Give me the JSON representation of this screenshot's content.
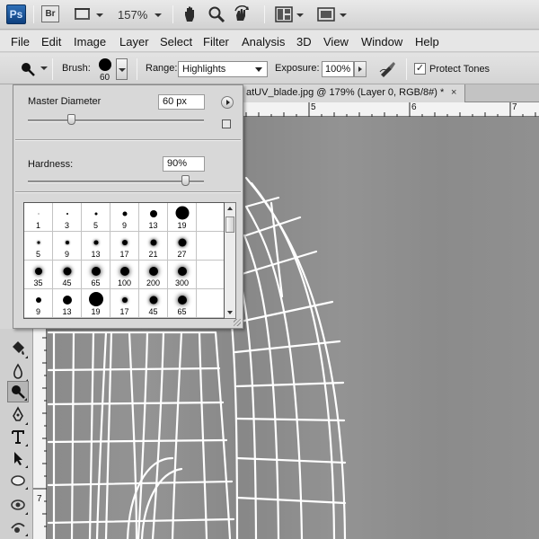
{
  "app": {
    "logo": "Ps",
    "bridge": "Br",
    "zoom": "157%"
  },
  "menu": [
    "File",
    "Edit",
    "Image",
    "Layer",
    "Select",
    "Filter",
    "Analysis",
    "3D",
    "View",
    "Window",
    "Help"
  ],
  "options": {
    "brush_label": "Brush:",
    "brush_size": "60",
    "range_label": "Range:",
    "range_value": "Highlights",
    "exposure_label": "Exposure:",
    "exposure_value": "100%",
    "protect_label": "Protect Tones",
    "protect_checked": "✓"
  },
  "brush_picker": {
    "diameter_label": "Master Diameter",
    "diameter_value": "60 px",
    "diameter_level": 0.25,
    "hardness_label": "Hardness:",
    "hardness_value": "90%",
    "hardness_level": 0.9,
    "presets": [
      "1",
      "3",
      "5",
      "9",
      "13",
      "19",
      "5",
      "9",
      "13",
      "17",
      "21",
      "27",
      "35",
      "45",
      "65",
      "100",
      "200",
      "300",
      "9",
      "13",
      "19",
      "17",
      "45",
      "65"
    ]
  },
  "document": {
    "tab_title": "atUV_blade.jpg @ 179% (Layer 0, RGB/8#) *",
    "close_glyph": "×",
    "ruler_h": [
      "5",
      "6",
      "7"
    ],
    "ruler_v": [
      "7"
    ]
  },
  "icons": {
    "hand": "hand-icon",
    "zoom": "zoom-icon",
    "rotate": "rotate-view-icon",
    "arrange": "arrange-documents-icon",
    "screen": "screen-mode-icon",
    "dodge": "dodge-tool-icon"
  },
  "colors": {
    "canvas": "#8e8e8e",
    "wire": "#ffffff",
    "ps_blue": "#1b5aa5"
  }
}
